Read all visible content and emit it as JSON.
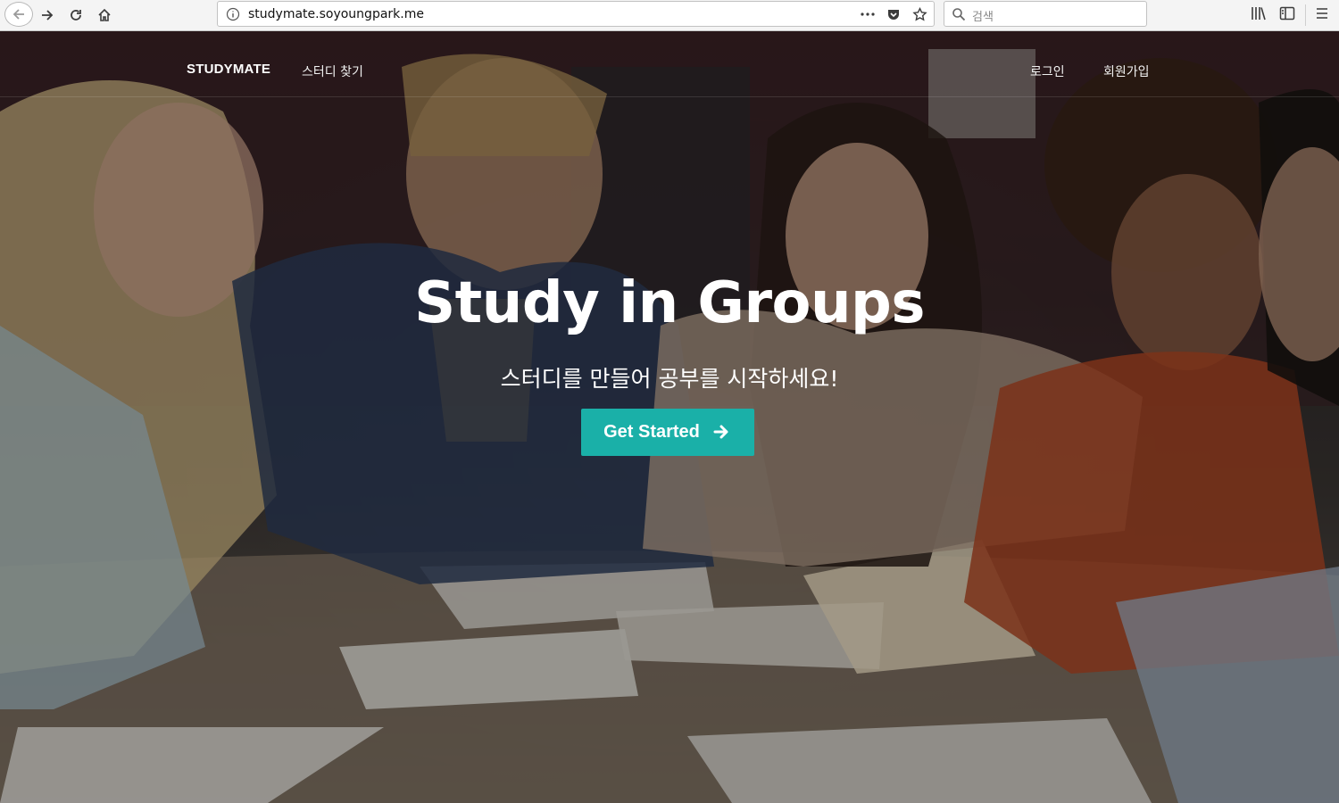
{
  "browser": {
    "url": "studymate.soyoungpark.me",
    "search_placeholder": "검색"
  },
  "nav": {
    "brand": "STUDYMATE",
    "find_study": "스터디 찾기",
    "login": "로그인",
    "signup": "회원가입"
  },
  "hero": {
    "title": "Study in Groups",
    "subtitle": "스터디를 만들어 공부를 시작하세요!",
    "cta_label": "Get Started"
  },
  "colors": {
    "accent": "#1ab0a8",
    "browser_bar": "#f4f4f4"
  },
  "icons": [
    "back-arrow-icon",
    "forward-arrow-icon",
    "reload-icon",
    "home-icon",
    "info-icon",
    "more-icon",
    "pocket-icon",
    "bookmark-star-icon",
    "search-icon",
    "library-icon",
    "sidebar-icon",
    "hamburger-menu-icon",
    "arrow-right-icon"
  ]
}
